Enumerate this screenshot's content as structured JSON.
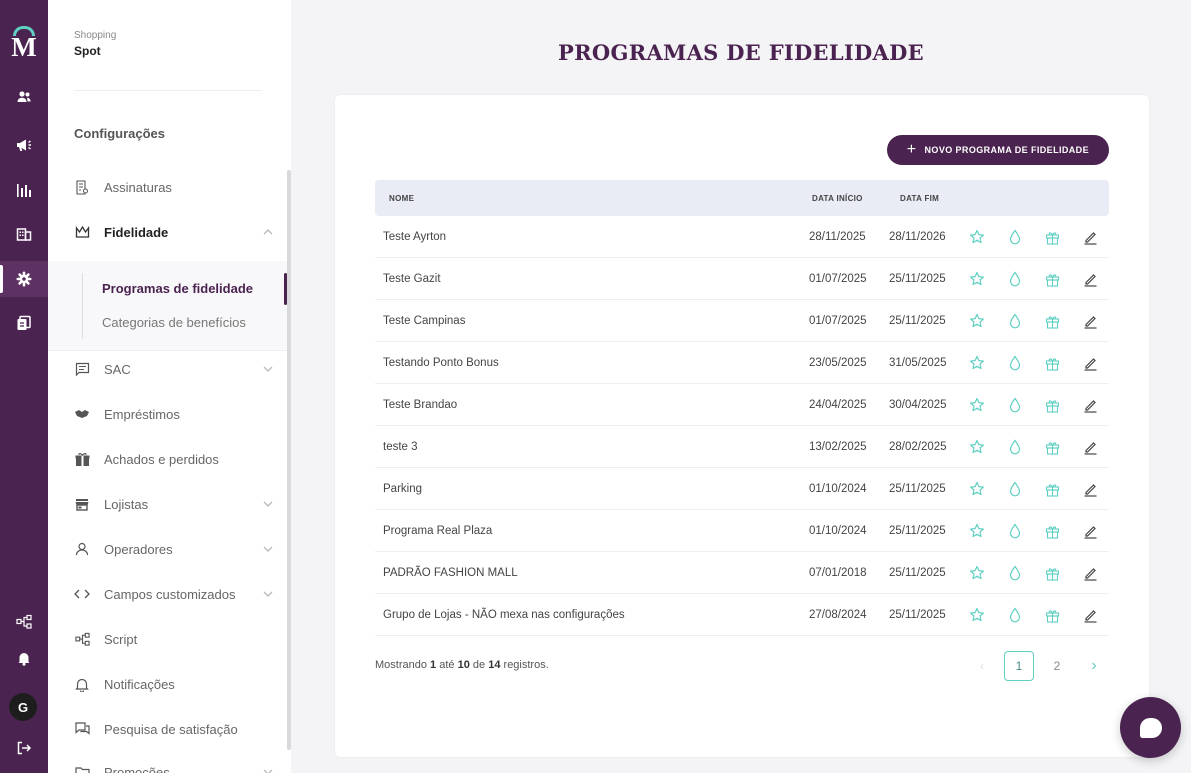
{
  "rail": {
    "logo_letter": "M",
    "items": [
      "users-icon",
      "megaphone-icon",
      "chart-icon",
      "building-icon",
      "gear-icon",
      "document-icon"
    ],
    "bottom_items": [
      "flow-icon",
      "bell-icon"
    ],
    "avatar_letter": "G",
    "logout": "logout-icon"
  },
  "sidebar": {
    "org_label": "Shopping",
    "org_name": "Spot",
    "section_title": "Configurações",
    "items": [
      {
        "label": "Assinaturas",
        "icon": "signature-icon"
      },
      {
        "label": "Fidelidade",
        "icon": "crown-icon"
      },
      {
        "label": "SAC",
        "icon": "message-icon"
      },
      {
        "label": "Empréstimos",
        "icon": "handshake-icon"
      },
      {
        "label": "Achados e perdidos",
        "icon": "gift-box-icon"
      },
      {
        "label": "Lojistas",
        "icon": "store-icon"
      },
      {
        "label": "Operadores",
        "icon": "person-icon"
      },
      {
        "label": "Campos customizados",
        "icon": "code-icon"
      },
      {
        "label": "Script",
        "icon": "flow-icon"
      },
      {
        "label": "Notificações",
        "icon": "bell-icon"
      },
      {
        "label": "Pesquisa de satisfação",
        "icon": "chat-icon"
      },
      {
        "label": "Promoções",
        "icon": "folder-icon"
      }
    ],
    "sub_items": [
      "Programas de fidelidade",
      "Categorias de benefícios"
    ]
  },
  "page": {
    "title": "PROGRAMAS DE FIDELIDADE",
    "new_button": "NOVO PROGRAMA DE FIDELIDADE",
    "columns": {
      "name": "NOME",
      "start": "DATA INÍCIO",
      "end": "DATA FIM"
    },
    "rows": [
      {
        "name": "Teste Ayrton",
        "start": "28/11/2025",
        "end": "28/11/2026"
      },
      {
        "name": "Teste Gazit",
        "start": "01/07/2025",
        "end": "25/11/2025"
      },
      {
        "name": "Teste Campinas",
        "start": "01/07/2025",
        "end": "25/11/2025"
      },
      {
        "name": "Testando Ponto Bonus",
        "start": "23/05/2025",
        "end": "31/05/2025"
      },
      {
        "name": "Teste Brandao",
        "start": "24/04/2025",
        "end": "30/04/2025"
      },
      {
        "name": "teste 3",
        "start": "13/02/2025",
        "end": "28/02/2025"
      },
      {
        "name": "Parking",
        "start": "01/10/2024",
        "end": "25/11/2025"
      },
      {
        "name": "Programa Real Plaza",
        "start": "01/10/2024",
        "end": "25/11/2025"
      },
      {
        "name": "PADRÃO FASHION MALL",
        "start": "07/01/2018",
        "end": "25/11/2025"
      },
      {
        "name": "Grupo de Lojas - NÃO mexa nas configurações",
        "start": "27/08/2024",
        "end": "25/11/2025"
      }
    ],
    "footer": {
      "prefix": "Mostrando",
      "from": "1",
      "mid1": "até",
      "to": "10",
      "mid2": "de",
      "total": "14",
      "suffix": "registros."
    },
    "pagination": {
      "prev": "‹",
      "pages": [
        "1",
        "2"
      ],
      "next": "›"
    }
  },
  "colors": {
    "brand": "#4b2350",
    "accent": "#5fd0c2"
  }
}
